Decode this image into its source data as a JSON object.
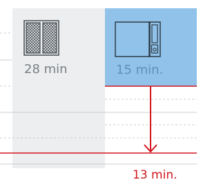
{
  "diagram": {
    "oven_a": {
      "icon": "oven-grid-icon",
      "time_label": "28 min"
    },
    "oven_b": {
      "icon": "microwave-oven-icon",
      "time_label": "15 min."
    },
    "difference": {
      "label": "13 min.",
      "arrow": "down-arrow"
    },
    "colors": {
      "gray_column": "#eceeef",
      "blue_column": "#91c3ea",
      "accent_red": "#d1141c",
      "gray_text": "#7a7f84",
      "blue_text": "#5f8fb8",
      "icon_dark": "#444a50"
    }
  }
}
